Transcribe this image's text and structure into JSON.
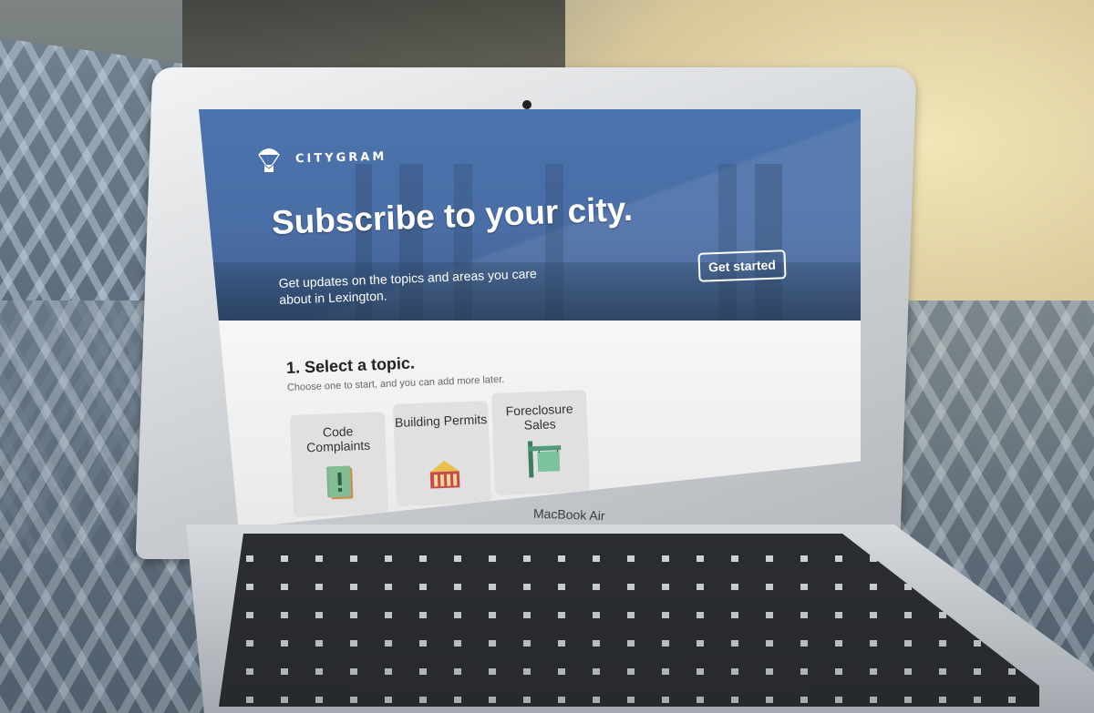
{
  "device": {
    "brand_label": "MacBook Air"
  },
  "site": {
    "logo_text": "CITYGRAM",
    "logo_icon": "parachute-envelope-icon"
  },
  "hero": {
    "headline": "Subscribe to your city.",
    "subtext": "Get updates on the topics and areas you care about in Lexington.",
    "cta_label": "Get started"
  },
  "step": {
    "title": "1. Select a topic.",
    "subtitle": "Choose one to start, and you can add more later."
  },
  "topics": [
    {
      "label": "Code Complaints",
      "icon": "exclamation-book-icon"
    },
    {
      "label": "Building Permits",
      "icon": "house-icon"
    },
    {
      "label": "Foreclosure Sales",
      "icon": "sale-sign-icon"
    }
  ],
  "colors": {
    "hero_blue": "#4b73ad",
    "card_bg": "#e0e0e0"
  }
}
